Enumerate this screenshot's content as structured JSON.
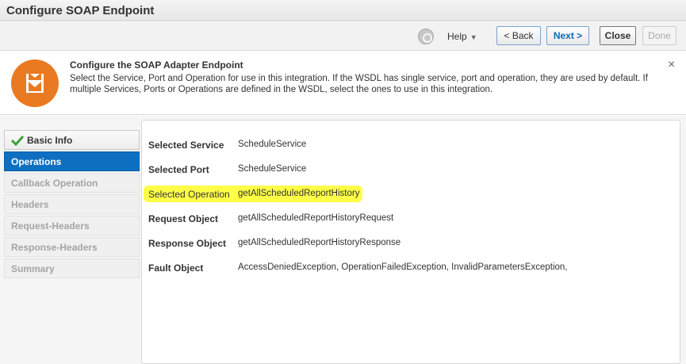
{
  "window": {
    "title": "Configure SOAP Endpoint"
  },
  "toolbar": {
    "help_label": "Help",
    "back_label": "< Back",
    "next_label": "Next >",
    "close_label": "Close",
    "done_label": "Done"
  },
  "banner": {
    "title": "Configure the SOAP Adapter Endpoint",
    "description": "Select the Service, Port and Operation for use in this integration. If the WSDL has single service, port and operation, they are used by default. If multiple Services, Ports or Operations are defined in the WSDL, select the ones to use in this integration.",
    "close_glyph": "×"
  },
  "nav": {
    "items": [
      {
        "label": "Basic Info",
        "state": "done"
      },
      {
        "label": "Operations",
        "state": "active"
      },
      {
        "label": "Callback Operation",
        "state": "disabled"
      },
      {
        "label": "Headers",
        "state": "disabled"
      },
      {
        "label": "Request-Headers",
        "state": "disabled"
      },
      {
        "label": "Response-Headers",
        "state": "disabled"
      },
      {
        "label": "Summary",
        "state": "disabled"
      }
    ]
  },
  "details": {
    "rows": [
      {
        "label": "Selected Service",
        "value": "ScheduleService"
      },
      {
        "label": "Selected Port",
        "value": "ScheduleService"
      },
      {
        "label": "Selected Operation",
        "value": "getAllScheduledReportHistory",
        "highlighted": true
      },
      {
        "label": "Request Object",
        "value": "getAllScheduledReportHistoryRequest"
      },
      {
        "label": "Response Object",
        "value": "getAllScheduledReportHistoryResponse"
      },
      {
        "label": "Fault Object",
        "value": "AccessDeniedException, OperationFailedException, InvalidParametersException,"
      }
    ]
  },
  "colors": {
    "accent": "#0e6fc1",
    "badge": "#ea7a22",
    "highlight": "#ffff33",
    "check": "#3aa335"
  },
  "icons": {
    "help": "help-circle-icon",
    "badge": "adapter-endpoint-icon",
    "check": "checkmark-icon",
    "close": "close-icon"
  }
}
